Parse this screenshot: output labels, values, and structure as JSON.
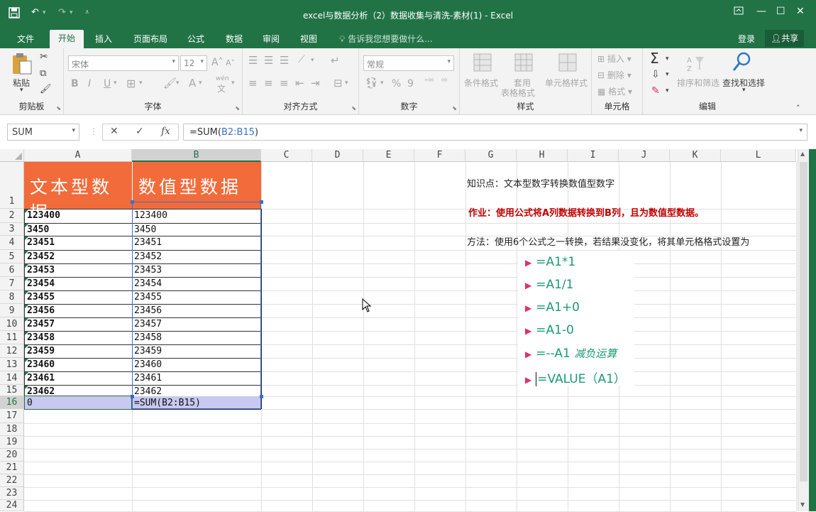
{
  "titlebar": {
    "title": "excel与数据分析（2）数据收集与清洗-素材(1) - Excel",
    "save_icon": "save-icon",
    "undo_icon": "undo-icon",
    "redo_icon": "redo-icon",
    "customize_icon": "customize-qat-icon",
    "controls": [
      "ribbon-display-icon",
      "minimize-icon",
      "restore-icon",
      "close-icon"
    ]
  },
  "tabs": {
    "items": [
      "文件",
      "开始",
      "插入",
      "页面布局",
      "公式",
      "数据",
      "审阅",
      "视图"
    ],
    "active": "开始",
    "tell_me": "告诉我您想要做什么...",
    "login": "登录",
    "share": "共享"
  },
  "ribbon": {
    "clipboard": {
      "label": "剪贴板",
      "paste": "粘贴"
    },
    "font": {
      "label": "字体",
      "font_name": "宋体",
      "font_size": "12",
      "bold": "B",
      "italic": "I",
      "underline": "U",
      "grow": "A",
      "shrink": "A",
      "color_a": "A",
      "wen": "wén"
    },
    "alignment": {
      "label": "对齐方式"
    },
    "number": {
      "label": "数字",
      "format": "常规",
      "percent": "%",
      "comma": "9"
    },
    "styles": {
      "label": "样式",
      "conditional": "条件格式",
      "table": "套用",
      "table2": "表格格式",
      "cell_styles": "单元格样式"
    },
    "cells": {
      "label": "单元格",
      "insert": "插入",
      "delete": "删除",
      "format": "格式"
    },
    "editing": {
      "label": "编辑",
      "sort": "排序和筛选",
      "find": "查找和选择",
      "sigma": "Σ"
    }
  },
  "formula_bar": {
    "name_box": "SUM",
    "cancel": "✕",
    "enter": "✓",
    "fx": "fx",
    "formula_prefix": "=SUM(",
    "formula_ref": "B2:B15",
    "formula_suffix": ")"
  },
  "sheet": {
    "columns": [
      "A",
      "B",
      "C",
      "D",
      "E",
      "F",
      "G",
      "H",
      "I",
      "J",
      "K",
      "L"
    ],
    "rows": [
      "1",
      "2",
      "3",
      "4",
      "5",
      "6",
      "7",
      "8",
      "9",
      "10",
      "11",
      "12",
      "13",
      "14",
      "15",
      "16",
      "17",
      "18",
      "19",
      "20",
      "21",
      "22",
      "23",
      "24"
    ],
    "header_a": "文本型数据",
    "header_b": "数值型数据",
    "col_a": [
      "123400",
      "3450",
      "23451",
      "23452",
      "23453",
      "23454",
      "23455",
      "23456",
      "23457",
      "23458",
      "23459",
      "23460",
      "23461",
      "23462",
      "0"
    ],
    "col_b": [
      "123400",
      "3450",
      "23451",
      "23452",
      "23453",
      "23454",
      "23455",
      "23456",
      "23457",
      "23458",
      "23459",
      "23460",
      "23461",
      "23462",
      "=SUM(B2:B15)"
    ],
    "note1": "知识点：文本型数字转换数值型数字",
    "note2": "作业：使用公式将A列数据转换到B列，且为数值型数据。",
    "note3": "方法：使用6个公式之一转换，若结果没变化，将其单元格格式设置为",
    "methods": [
      "=A1*1",
      "=A1/1",
      "=A1+0",
      "=A1-0",
      "=--A1",
      "=VALUE（A1）"
    ],
    "method5_note": "减负运算"
  },
  "colors": {
    "excel_green": "#217346",
    "header_orange": "#f26b3a",
    "selection": "#c8c8f0",
    "red_text": "#c00000",
    "method_green": "#1a9a72",
    "arrow_pink": "#e0306a"
  }
}
